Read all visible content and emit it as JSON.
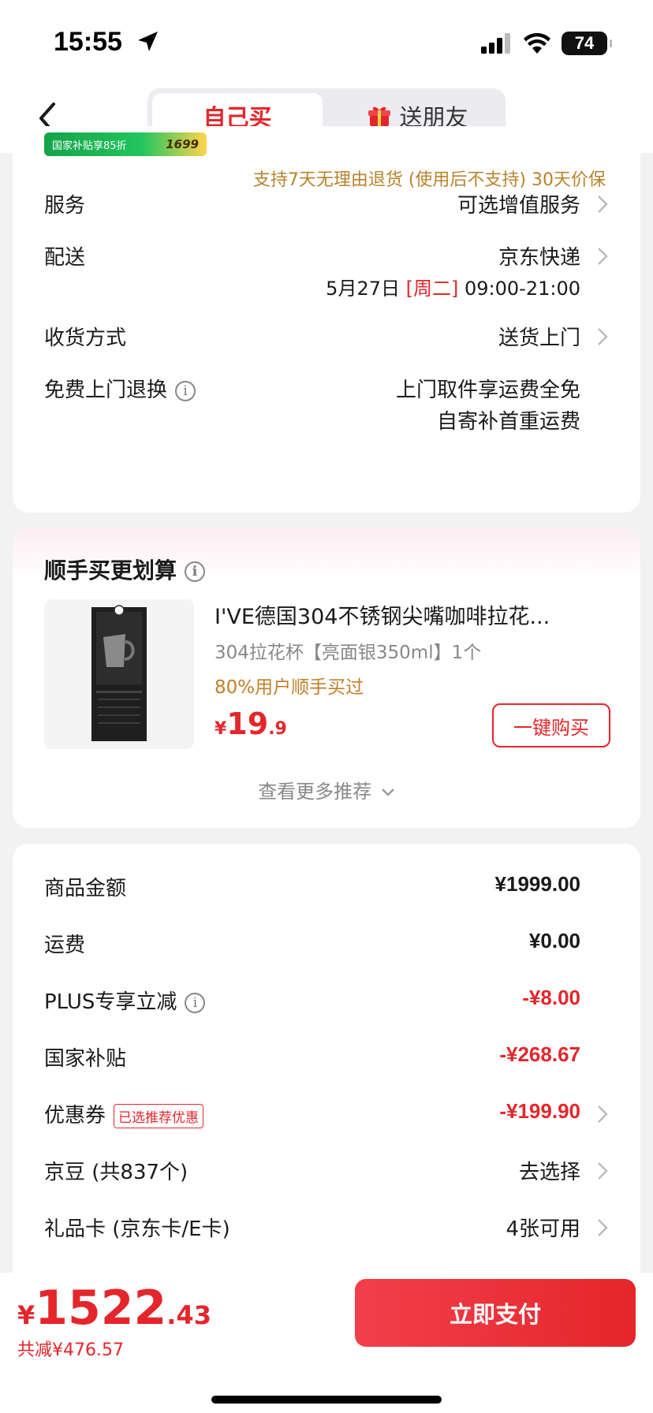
{
  "status_bar": {
    "time": "15:55",
    "battery": "74"
  },
  "header": {
    "tab_self": "自己买",
    "tab_friend": "送朋友"
  },
  "shipping_card": {
    "subsidy_banner_text": "国家补贴享85折",
    "subsidy_banner_price": "1699",
    "return_policy": "支持7天无理由退货 (使用后不支持)   30天价保",
    "rows": [
      {
        "label": "服务",
        "value": "可选增值服务"
      },
      {
        "label": "配送",
        "value": "京东快递",
        "date": "5月27日",
        "weekday": "[周二]",
        "time": "09:00-21:00"
      },
      {
        "label": "收货方式",
        "value": "送货上门"
      },
      {
        "label": "免费上门退换",
        "value_line1": "上门取件享运费全免",
        "value_line2": "自寄补首重运费"
      }
    ]
  },
  "addon": {
    "title": "顺手买更划算",
    "product": {
      "title": "I'VE德国304不锈钢尖嘴咖啡拉花...",
      "spec": "304拉花杯【亮面银350ml】1个",
      "social_proof": "80%用户顺手买过",
      "price_currency": "¥",
      "price_int": "19",
      "price_dec": ".9",
      "buy_label": "一键购买"
    },
    "more_label": "查看更多推荐"
  },
  "summary": {
    "rows": [
      {
        "label": "商品金额",
        "value": "¥1999.00"
      },
      {
        "label": "运费",
        "value": "¥0.00"
      },
      {
        "label": "PLUS专享立减",
        "value": "-¥8.00"
      },
      {
        "label": "国家补贴",
        "value": "-¥268.67"
      },
      {
        "label": "优惠券",
        "tag": "已选推荐优惠",
        "value": "-¥199.90"
      },
      {
        "label": "京豆 (共837个)",
        "value": "去选择"
      },
      {
        "label": "礼品卡 (京东卡/E卡)",
        "value": "4张可用"
      }
    ]
  },
  "bottom": {
    "total_currency": "¥",
    "total_int": "1522",
    "total_dec": ".43",
    "saved": "共减¥476.57",
    "pay_label": "立即支付"
  },
  "colors": {
    "accent": "#e4262b",
    "gold": "#b8832c"
  }
}
